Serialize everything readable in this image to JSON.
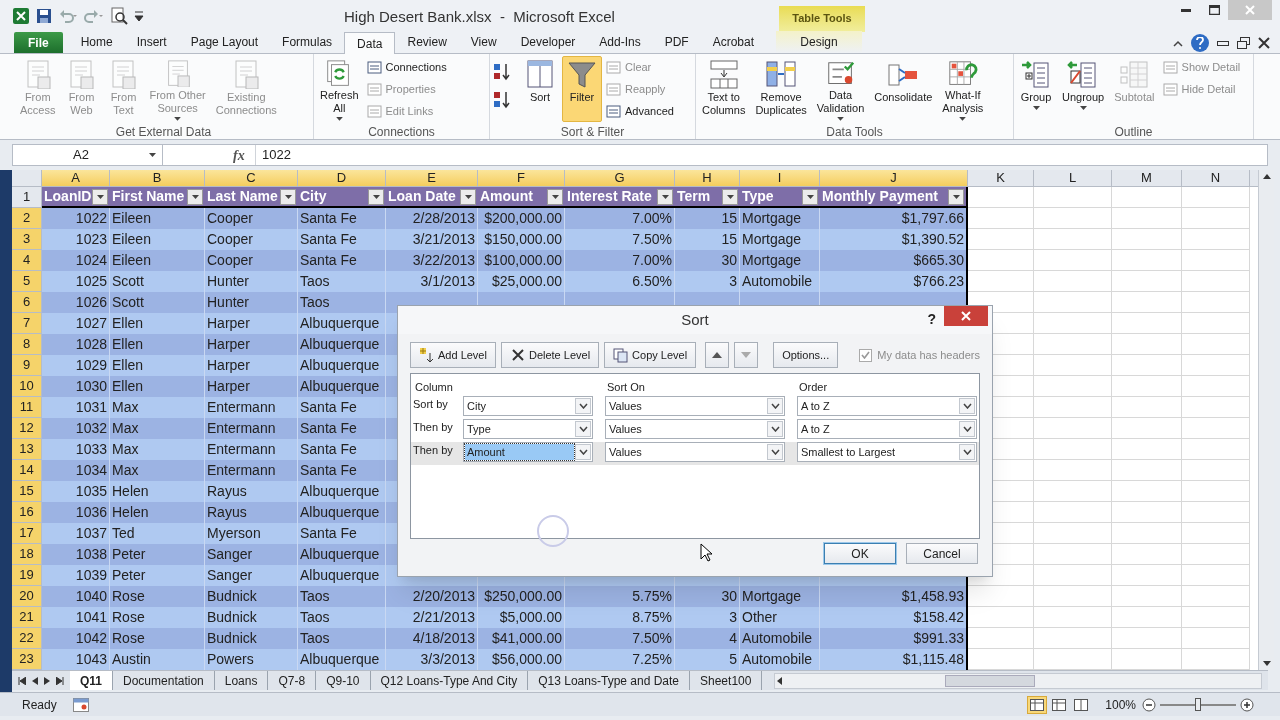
{
  "window": {
    "title": "High Desert Bank.xlsx  -  Microsoft Excel",
    "contextual_group": "Table Tools"
  },
  "ribbon_tabs": [
    {
      "label": "File",
      "kind": "file",
      "selected": false
    },
    {
      "label": "Home",
      "kind": "normal",
      "selected": false
    },
    {
      "label": "Insert",
      "kind": "normal",
      "selected": false
    },
    {
      "label": "Page Layout",
      "kind": "normal",
      "selected": false
    },
    {
      "label": "Formulas",
      "kind": "normal",
      "selected": false
    },
    {
      "label": "Data",
      "kind": "normal",
      "selected": true
    },
    {
      "label": "Review",
      "kind": "normal",
      "selected": false
    },
    {
      "label": "View",
      "kind": "normal",
      "selected": false
    },
    {
      "label": "Developer",
      "kind": "normal",
      "selected": false
    },
    {
      "label": "Add-Ins",
      "kind": "normal",
      "selected": false
    },
    {
      "label": "PDF",
      "kind": "normal",
      "selected": false
    },
    {
      "label": "Acrobat",
      "kind": "normal",
      "selected": false
    },
    {
      "label": "Design",
      "kind": "contextual",
      "selected": false
    }
  ],
  "ribbon_groups": [
    {
      "label": "Get External Data",
      "items": [
        {
          "kind": "large",
          "label": "From\nAccess",
          "disabled": true,
          "has_menu": false,
          "pressed": false
        },
        {
          "kind": "large",
          "label": "From\nWeb",
          "disabled": true,
          "has_menu": false,
          "pressed": false
        },
        {
          "kind": "large",
          "label": "From\nText",
          "disabled": true,
          "has_menu": false,
          "pressed": false
        },
        {
          "kind": "large",
          "label": "From Other\nSources",
          "disabled": true,
          "has_menu": true,
          "pressed": false
        },
        {
          "kind": "large",
          "label": "Existing\nConnections",
          "disabled": true,
          "has_menu": false,
          "pressed": false
        }
      ]
    },
    {
      "label": "Connections",
      "items": [
        {
          "kind": "large",
          "label": "Refresh\nAll",
          "disabled": false,
          "has_menu": true,
          "pressed": false
        },
        {
          "kind": "stack",
          "items": [
            {
              "label": "Connections",
              "disabled": false
            },
            {
              "label": "Properties",
              "disabled": true
            },
            {
              "label": "Edit Links",
              "disabled": true
            }
          ]
        }
      ]
    },
    {
      "label": "Sort & Filter",
      "items": [
        {
          "kind": "icon_stack",
          "items": [
            {
              "disabled": false
            },
            {
              "disabled": false
            }
          ]
        },
        {
          "kind": "large",
          "label": "Sort",
          "disabled": false,
          "has_menu": false,
          "pressed": false
        },
        {
          "kind": "large",
          "label": "Filter",
          "disabled": false,
          "has_menu": false,
          "pressed": true
        },
        {
          "kind": "stack",
          "items": [
            {
              "label": "Clear",
              "disabled": true
            },
            {
              "label": "Reapply",
              "disabled": true
            },
            {
              "label": "Advanced",
              "disabled": false
            }
          ]
        }
      ]
    },
    {
      "label": "Data Tools",
      "items": [
        {
          "kind": "large",
          "label": "Text to\nColumns",
          "disabled": false,
          "has_menu": false,
          "pressed": false
        },
        {
          "kind": "large",
          "label": "Remove\nDuplicates",
          "disabled": false,
          "has_menu": false,
          "pressed": false
        },
        {
          "kind": "large",
          "label": "Data\nValidation",
          "disabled": false,
          "has_menu": true,
          "pressed": false
        },
        {
          "kind": "large",
          "label": "Consolidate",
          "disabled": false,
          "has_menu": false,
          "pressed": false
        },
        {
          "kind": "large",
          "label": "What-If\nAnalysis",
          "disabled": false,
          "has_menu": true,
          "pressed": false
        }
      ]
    },
    {
      "label": "Outline",
      "items": [
        {
          "kind": "large",
          "label": "Group",
          "disabled": false,
          "has_menu": true,
          "pressed": false
        },
        {
          "kind": "large",
          "label": "Ungroup",
          "disabled": false,
          "has_menu": true,
          "pressed": false
        },
        {
          "kind": "large",
          "label": "Subtotal",
          "disabled": true,
          "has_menu": false,
          "pressed": false
        },
        {
          "kind": "stack",
          "items": [
            {
              "label": "Show Detail",
              "disabled": true
            },
            {
              "label": "Hide Detail",
              "disabled": true
            }
          ]
        }
      ]
    }
  ],
  "formula_bar": {
    "name_box": "A2",
    "function_label": "fx",
    "value": "1022"
  },
  "sheet": {
    "columns": [
      {
        "letter": "A",
        "selected": true
      },
      {
        "letter": "B",
        "selected": true
      },
      {
        "letter": "C",
        "selected": true
      },
      {
        "letter": "D",
        "selected": true
      },
      {
        "letter": "E",
        "selected": true
      },
      {
        "letter": "F",
        "selected": true
      },
      {
        "letter": "G",
        "selected": true
      },
      {
        "letter": "H",
        "selected": true
      },
      {
        "letter": "I",
        "selected": true
      },
      {
        "letter": "J",
        "selected": true
      },
      {
        "letter": "K",
        "selected": false
      },
      {
        "letter": "L",
        "selected": false
      },
      {
        "letter": "M",
        "selected": false
      },
      {
        "letter": "N",
        "selected": false
      }
    ],
    "header_row": {
      "number": "1",
      "selected": false,
      "cells": [
        "LoanID",
        "First Name",
        "Last Name",
        "City",
        "Loan Date",
        "Amount",
        "Interest Rate",
        "Term",
        "Type",
        "Monthly Payment"
      ]
    },
    "rows": [
      {
        "number": "2",
        "selected": true,
        "cells": [
          "1022",
          "Eileen",
          "Cooper",
          "Santa Fe",
          "2/28/2013",
          "$200,000.00",
          "7.00%",
          "15",
          "Mortgage",
          "$1,797.66"
        ]
      },
      {
        "number": "3",
        "selected": true,
        "cells": [
          "1023",
          "Eileen",
          "Cooper",
          "Santa Fe",
          "3/21/2013",
          "$150,000.00",
          "7.50%",
          "15",
          "Mortgage",
          "$1,390.52"
        ]
      },
      {
        "number": "4",
        "selected": true,
        "cells": [
          "1024",
          "Eileen",
          "Cooper",
          "Santa Fe",
          "3/22/2013",
          "$100,000.00",
          "7.00%",
          "30",
          "Mortgage",
          "$665.30"
        ]
      },
      {
        "number": "5",
        "selected": true,
        "cells": [
          "1025",
          "Scott",
          "Hunter",
          "Taos",
          "3/1/2013",
          "$25,000.00",
          "6.50%",
          "3",
          "Automobile",
          "$766.23"
        ]
      },
      {
        "number": "6",
        "selected": true,
        "cells": [
          "1026",
          "Scott",
          "Hunter",
          "Taos"
        ]
      },
      {
        "number": "7",
        "selected": true,
        "cells": [
          "1027",
          "Ellen",
          "Harper",
          "Albuquerque"
        ]
      },
      {
        "number": "8",
        "selected": true,
        "cells": [
          "1028",
          "Ellen",
          "Harper",
          "Albuquerque"
        ]
      },
      {
        "number": "9",
        "selected": true,
        "cells": [
          "1029",
          "Ellen",
          "Harper",
          "Albuquerque"
        ]
      },
      {
        "number": "10",
        "selected": true,
        "cells": [
          "1030",
          "Ellen",
          "Harper",
          "Albuquerque"
        ]
      },
      {
        "number": "11",
        "selected": true,
        "cells": [
          "1031",
          "Max",
          "Entermann",
          "Santa Fe"
        ]
      },
      {
        "number": "12",
        "selected": true,
        "cells": [
          "1032",
          "Max",
          "Entermann",
          "Santa Fe"
        ]
      },
      {
        "number": "13",
        "selected": true,
        "cells": [
          "1033",
          "Max",
          "Entermann",
          "Santa Fe"
        ]
      },
      {
        "number": "14",
        "selected": true,
        "cells": [
          "1034",
          "Max",
          "Entermann",
          "Santa Fe"
        ]
      },
      {
        "number": "15",
        "selected": true,
        "cells": [
          "1035",
          "Helen",
          "Rayus",
          "Albuquerque"
        ]
      },
      {
        "number": "16",
        "selected": true,
        "cells": [
          "1036",
          "Helen",
          "Rayus",
          "Albuquerque"
        ]
      },
      {
        "number": "17",
        "selected": true,
        "cells": [
          "1037",
          "Ted",
          "Myerson",
          "Santa Fe"
        ]
      },
      {
        "number": "18",
        "selected": true,
        "cells": [
          "1038",
          "Peter",
          "Sanger",
          "Albuquerque"
        ]
      },
      {
        "number": "19",
        "selected": true,
        "cells": [
          "1039",
          "Peter",
          "Sanger",
          "Albuquerque"
        ]
      },
      {
        "number": "20",
        "selected": true,
        "cells": [
          "1040",
          "Rose",
          "Budnick",
          "Taos",
          "2/20/2013",
          "$250,000.00",
          "5.75%",
          "30",
          "Mortgage",
          "$1,458.93"
        ]
      },
      {
        "number": "21",
        "selected": true,
        "cells": [
          "1041",
          "Rose",
          "Budnick",
          "Taos",
          "2/21/2013",
          "$5,000.00",
          "8.75%",
          "3",
          "Other",
          "$158.42"
        ]
      },
      {
        "number": "22",
        "selected": true,
        "cells": [
          "1042",
          "Rose",
          "Budnick",
          "Taos",
          "4/18/2013",
          "$41,000.00",
          "7.50%",
          "4",
          "Automobile",
          "$991.33"
        ]
      },
      {
        "number": "23",
        "selected": true,
        "cells": [
          "1043",
          "Austin",
          "Powers",
          "Albuquerque",
          "3/3/2013",
          "$56,000.00",
          "7.25%",
          "5",
          "Automobile",
          "$1,115.48"
        ]
      }
    ]
  },
  "sheet_tabs": [
    {
      "label": "Q11",
      "selected": true
    },
    {
      "label": "Documentation",
      "selected": false
    },
    {
      "label": "Loans",
      "selected": false
    },
    {
      "label": "Q7-8",
      "selected": false
    },
    {
      "label": "Q9-10",
      "selected": false
    },
    {
      "label": "Q12 Loans-Type And City",
      "selected": false
    },
    {
      "label": "Q13 Loans-Type and Date",
      "selected": false
    },
    {
      "label": "Sheet100",
      "selected": false
    }
  ],
  "status_bar": {
    "text": "Ready",
    "views": [
      {
        "selected": true
      },
      {
        "selected": false
      },
      {
        "selected": false
      }
    ],
    "zoom": "100%",
    "zoom_slider": {
      "level": 0.5
    }
  },
  "sort_dialog": {
    "title": "Sort",
    "help": "?",
    "toolbar": [
      {
        "kind": "text",
        "label": "Add Level",
        "disabled": false
      },
      {
        "kind": "text",
        "label": "Delete Level",
        "disabled": false
      },
      {
        "kind": "text",
        "label": "Copy Level",
        "disabled": false
      },
      {
        "kind": "up",
        "disabled": false
      },
      {
        "kind": "down",
        "disabled": true
      },
      {
        "kind": "text",
        "label": "Options...",
        "disabled": false
      }
    ],
    "headers_checkbox": {
      "label": "My data has headers",
      "checked": true,
      "disabled": true
    },
    "columns": [
      "Column",
      "Sort On",
      "Order"
    ],
    "levels": [
      {
        "label": "Sort by",
        "column": "City",
        "sort_on": "Values",
        "order": "A to Z",
        "selected": false
      },
      {
        "label": "Then by",
        "column": "Type",
        "sort_on": "Values",
        "order": "A to Z",
        "selected": false
      },
      {
        "label": "Then by",
        "column": "Amount",
        "sort_on": "Values",
        "order": "Smallest to Largest",
        "selected": true
      }
    ],
    "buttons": [
      {
        "label": "OK",
        "default": true
      },
      {
        "label": "Cancel",
        "default": false
      }
    ]
  }
}
